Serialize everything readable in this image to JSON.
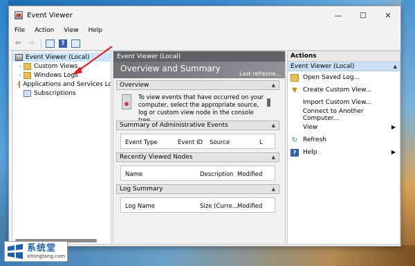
{
  "window": {
    "title": "Event Viewer",
    "controls": {
      "minimize": "—",
      "maximize": "☐",
      "close": "✕"
    }
  },
  "menu": [
    "File",
    "Action",
    "View",
    "Help"
  ],
  "toolbar": {
    "back": "⇦",
    "forward": "⇨",
    "help": "?"
  },
  "tree": {
    "root": "Event Viewer (Local)",
    "items": [
      {
        "label": "Custom Views",
        "icon": "folder-icon"
      },
      {
        "label": "Windows Logs",
        "icon": "folder-icon"
      },
      {
        "label": "Applications and Services Logs",
        "icon": "folder-icon"
      },
      {
        "label": "Subscriptions",
        "icon": "subscriptions-icon"
      }
    ]
  },
  "middle": {
    "header": "Event Viewer (Local)",
    "banner_title": "Overview and Summary",
    "banner_refresh": "Last refreshe...",
    "overview_title": "Overview",
    "overview_text": "To view events that have occurred on your computer, select the appropriate source, log or custom view node in the console tree.",
    "admin_title": "Summary of Administrative Events",
    "admin_cols": [
      "Event Type",
      "Event ID",
      "Source",
      "L"
    ],
    "recent_title": "Recently Viewed Nodes",
    "recent_cols": [
      "Name",
      "Description",
      "Modified"
    ],
    "log_title": "Log Summary",
    "log_cols": [
      "Log Name",
      "Size (Curre...",
      "Modified"
    ]
  },
  "actions": {
    "header": "Actions",
    "selected": "Event Viewer (Local)",
    "items": [
      {
        "label": "Open Saved Log...",
        "icon": "open-folder-icon"
      },
      {
        "label": "Create Custom View...",
        "icon": "filter-icon"
      },
      {
        "label": "Import Custom View...",
        "icon": ""
      },
      {
        "label": "Connect to Another Computer...",
        "icon": ""
      },
      {
        "label": "View",
        "icon": "",
        "submenu": true
      },
      {
        "label": "Refresh",
        "icon": "refresh-icon"
      },
      {
        "label": "Help",
        "icon": "help-icon",
        "submenu": true
      }
    ]
  },
  "watermark": {
    "cn": "系统堂",
    "url": "xitongtang.com"
  },
  "colors": {
    "annotation": "#e02020",
    "pane_header": "#5f6368",
    "selection": "#cce4f7"
  }
}
